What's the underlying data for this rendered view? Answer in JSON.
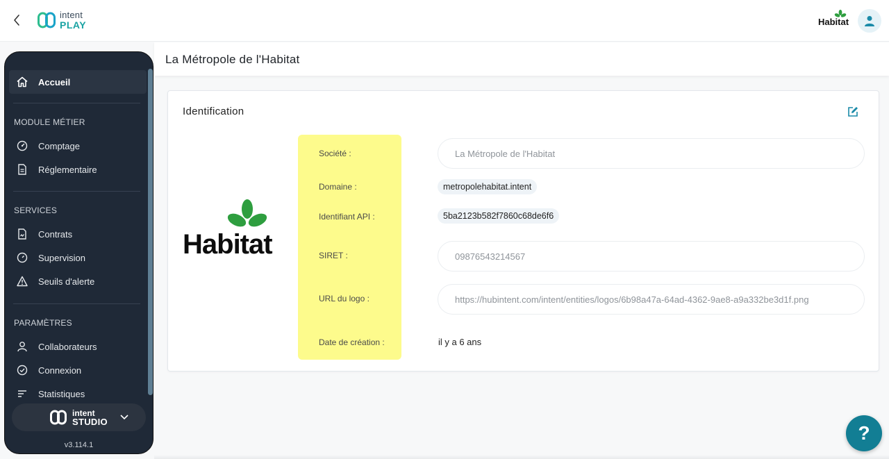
{
  "app": {
    "brand_line1": "intent",
    "brand_line2": "PLAY"
  },
  "header": {
    "org_logo_text": "Habitat"
  },
  "sidebar": {
    "home": "Accueil",
    "sections": [
      {
        "title": "MODULE MÉTIER",
        "items": [
          "Comptage",
          "Réglementaire"
        ]
      },
      {
        "title": "SERVICES",
        "items": [
          "Contrats",
          "Supervision",
          "Seuils d'alerte"
        ]
      },
      {
        "title": "PARAMÈTRES",
        "items": [
          "Collaborateurs",
          "Connexion",
          "Statistiques"
        ]
      }
    ],
    "studio_line1": "intent",
    "studio_line2": "STUDIO",
    "version": "v3.114.1"
  },
  "page": {
    "title": "La Métropole de l'Habitat"
  },
  "card": {
    "title": "Identification",
    "logo_text": "Habitat",
    "labels": {
      "societe": "Société :",
      "domaine": "Domaine :",
      "api": "Identifiant API :",
      "siret": "SIRET :",
      "logo_url": "URL du logo :",
      "date": "Date de création :"
    },
    "values": {
      "societe": "La Métropole de l'Habitat",
      "domaine": "metropolehabitat.intent",
      "api": "5ba2123b582f7860c68de6f6",
      "siret": "09876543214567",
      "logo_url": "https://hubintent.com/intent/entities/logos/6b98a47a-64ad-4362-9ae8-a9a332be3d1f.png",
      "date": "il y a 6 ans"
    }
  },
  "help": {
    "label": "?"
  },
  "colors": {
    "accent": "#1aa3a3",
    "highlight": "#fdfb8c",
    "sidebar_bg": "#1f2937",
    "logo_green": "#2e9e3f"
  }
}
